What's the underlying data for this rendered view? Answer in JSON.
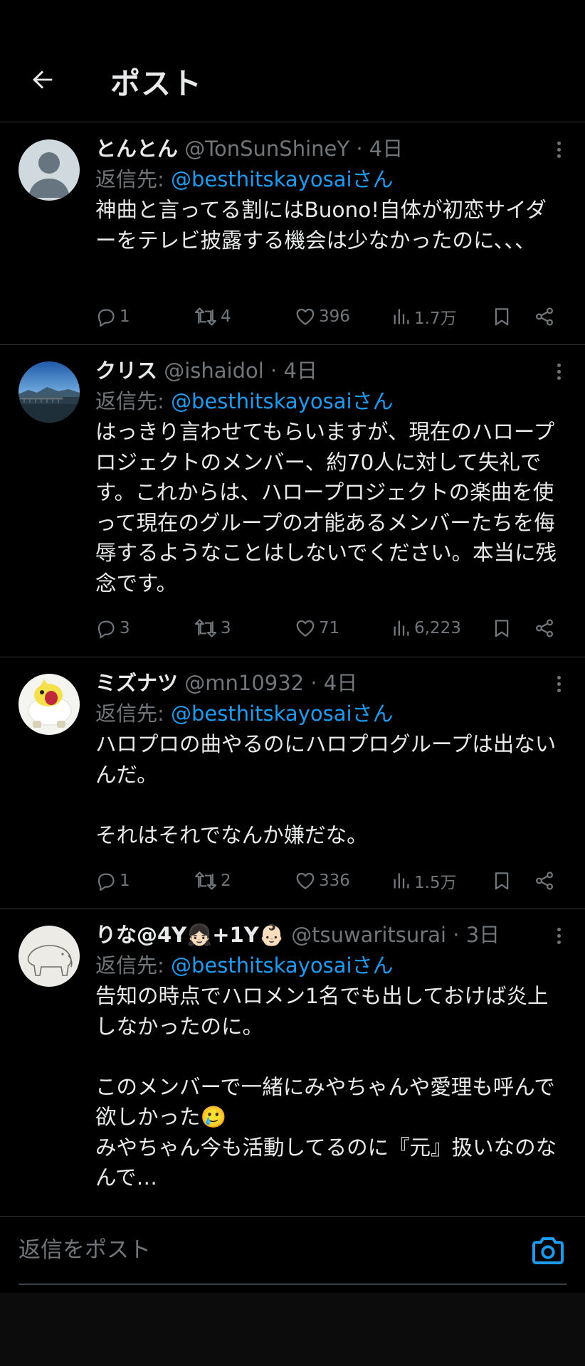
{
  "header": {
    "title": "ポスト",
    "back_icon": "arrow-left-icon"
  },
  "colors": {
    "background": "#000000",
    "text": "#e7e9ea",
    "muted": "#71767b",
    "link": "#1d9bf0",
    "divider": "#2f3336"
  },
  "tweets": [
    {
      "name": "とんとん",
      "handle": "@TonSunShineY",
      "dot": "·",
      "time": "4日",
      "reply_prefix": "返信先: ",
      "reply_to": "@besthitskayosaiさん",
      "body": "神曲と言ってる割にはBuono!自体が初恋サイダーをテレビ披露する機会は少なかったのに、、、",
      "replies": "1",
      "retweets": "4",
      "likes": "396",
      "views": "1.7万"
    },
    {
      "name": "クリス",
      "handle": "@ishaidol",
      "dot": "·",
      "time": "4日",
      "reply_prefix": "返信先: ",
      "reply_to": "@besthitskayosaiさん",
      "body": "はっきり言わせてもらいますが、現在のハロープロジェクトのメンバー、約70人に対して失礼です。これからは、ハロープロジェクトの楽曲を使って現在のグループの才能あるメンバーたちを侮辱するようなことはしないでください。本当に残念です。",
      "replies": "3",
      "retweets": "3",
      "likes": "71",
      "views": "6,223"
    },
    {
      "name": "ミズナツ",
      "handle": "@mn10932",
      "dot": "·",
      "time": "4日",
      "reply_prefix": "返信先: ",
      "reply_to": "@besthitskayosaiさん",
      "body": "ハロプロの曲やるのにハロプログループは出ないんだ。\n\nそれはそれでなんか嫌だな。",
      "replies": "1",
      "retweets": "2",
      "likes": "336",
      "views": "1.5万"
    },
    {
      "name": "りな@4Y👧🏻+1Y👶🏻",
      "handle": "@tsuwaritsurai",
      "dot": "·",
      "time": "3日",
      "reply_prefix": "返信先: ",
      "reply_to": "@besthitskayosaiさん",
      "body": "告知の時点でハロメン1名でも出しておけば炎上しなかったのに。\n\nこのメンバーで一緒にみやちゃんや愛理も呼んで欲しかった🥲\nみやちゃん今も活動してるのに『元』扱いなのなんで…"
    }
  ],
  "reply_bar": {
    "placeholder": "返信をポスト",
    "camera_icon": "camera-icon"
  }
}
